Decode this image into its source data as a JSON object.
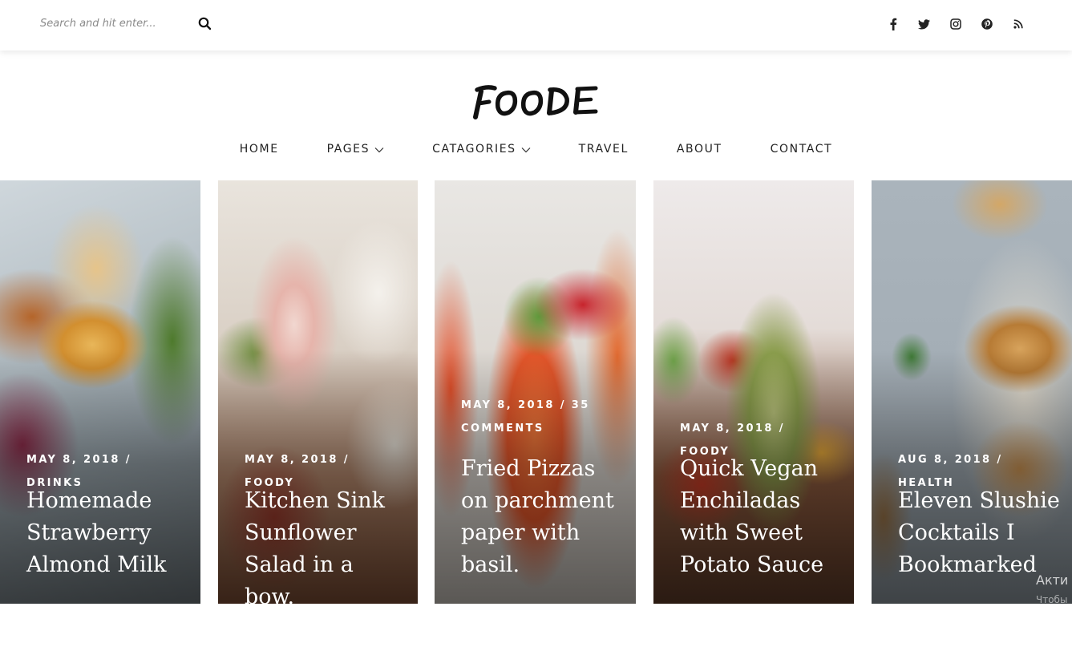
{
  "search": {
    "placeholder": "Search and hit enter..."
  },
  "social": [
    "facebook-icon",
    "twitter-icon",
    "instagram-icon",
    "pinterest-icon",
    "rss-icon"
  ],
  "logo": {
    "text": "FOODE"
  },
  "nav": [
    {
      "label": "HOME",
      "dropdown": false
    },
    {
      "label": "PAGES",
      "dropdown": true
    },
    {
      "label": "CATAGORIES",
      "dropdown": true
    },
    {
      "label": "TRAVEL",
      "dropdown": false
    },
    {
      "label": "ABOUT",
      "dropdown": false
    },
    {
      "label": "CONTACT",
      "dropdown": false
    }
  ],
  "cards": [
    {
      "meta": "MAY 8, 2018 / DRINKS",
      "title": "Homemade Strawberry Almond Milk"
    },
    {
      "meta": "MAY 8, 2018 / FOODY",
      "title": "Kitchen Sink Sunflower Salad in a bow."
    },
    {
      "meta": "MAY 8, 2018 / 35 COMMENTS",
      "title": "Fried Pizzas on parchment paper with basil."
    },
    {
      "meta": "MAY 8, 2018 / FOODY",
      "title": "Quick Vegan Enchiladas with Sweet Potato Sauce"
    },
    {
      "meta": "AUG 8, 2018 / HEALTH",
      "title": "Eleven Slushie Cocktails I Bookmarked"
    }
  ],
  "watermark": {
    "line1": "Акти",
    "line2": "Чтобы"
  },
  "colors": {
    "text": "#222222",
    "overlay_text": "#ffffff",
    "background": "#ffffff"
  }
}
